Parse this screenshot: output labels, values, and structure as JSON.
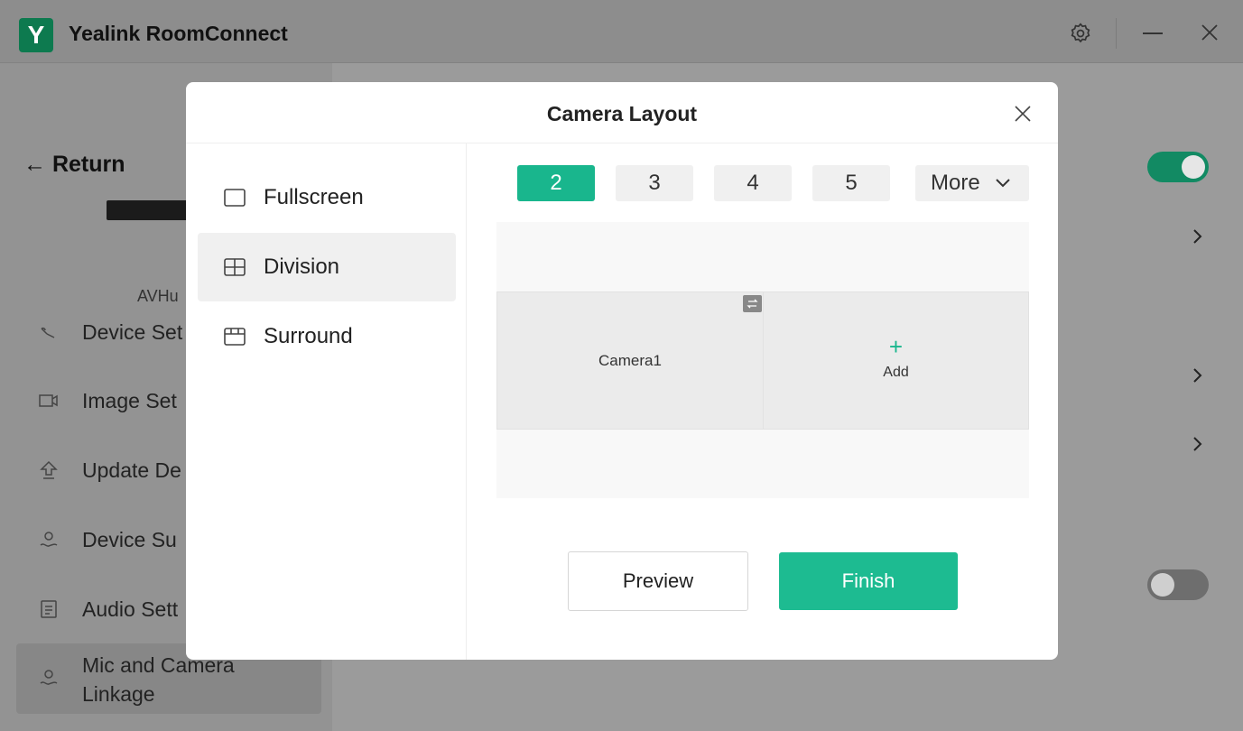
{
  "app": {
    "logo_letter": "Y",
    "title": "Yealink RoomConnect"
  },
  "titlebar": {
    "settings_icon": "gear-icon",
    "minimize_icon": "minimize-icon",
    "close_icon": "close-icon"
  },
  "sidebar": {
    "return_label": "Return",
    "device_name": "AVHu",
    "items": [
      {
        "label": "Device Set",
        "icon": "device-settings-icon"
      },
      {
        "label": "Image Set",
        "icon": "camera-icon"
      },
      {
        "label": "Update De",
        "icon": "update-icon"
      },
      {
        "label": "Device Su",
        "icon": "support-icon"
      },
      {
        "label": "Audio Sett",
        "icon": "audio-doc-icon"
      },
      {
        "label": "Mic and Camera Linkage",
        "icon": "linkage-icon",
        "active": true
      }
    ]
  },
  "background_controls": {
    "toggle1_on": true,
    "toggle2_on": false,
    "accent_color": "#128a63"
  },
  "modal": {
    "title": "Camera Layout",
    "layout_options": [
      {
        "label": "Fullscreen",
        "icon": "fullscreen-icon",
        "active": false
      },
      {
        "label": "Division",
        "icon": "division-grid-icon",
        "active": true
      },
      {
        "label": "Surround",
        "icon": "surround-icon",
        "active": false
      }
    ],
    "counts": [
      "2",
      "3",
      "4",
      "5"
    ],
    "selected_count": "2",
    "more_label": "More",
    "cells": [
      {
        "label": "Camera1"
      },
      {
        "label": "Add",
        "symbol": "+"
      }
    ],
    "preview_label": "Preview",
    "finish_label": "Finish",
    "accent_color": "#19b68d"
  }
}
